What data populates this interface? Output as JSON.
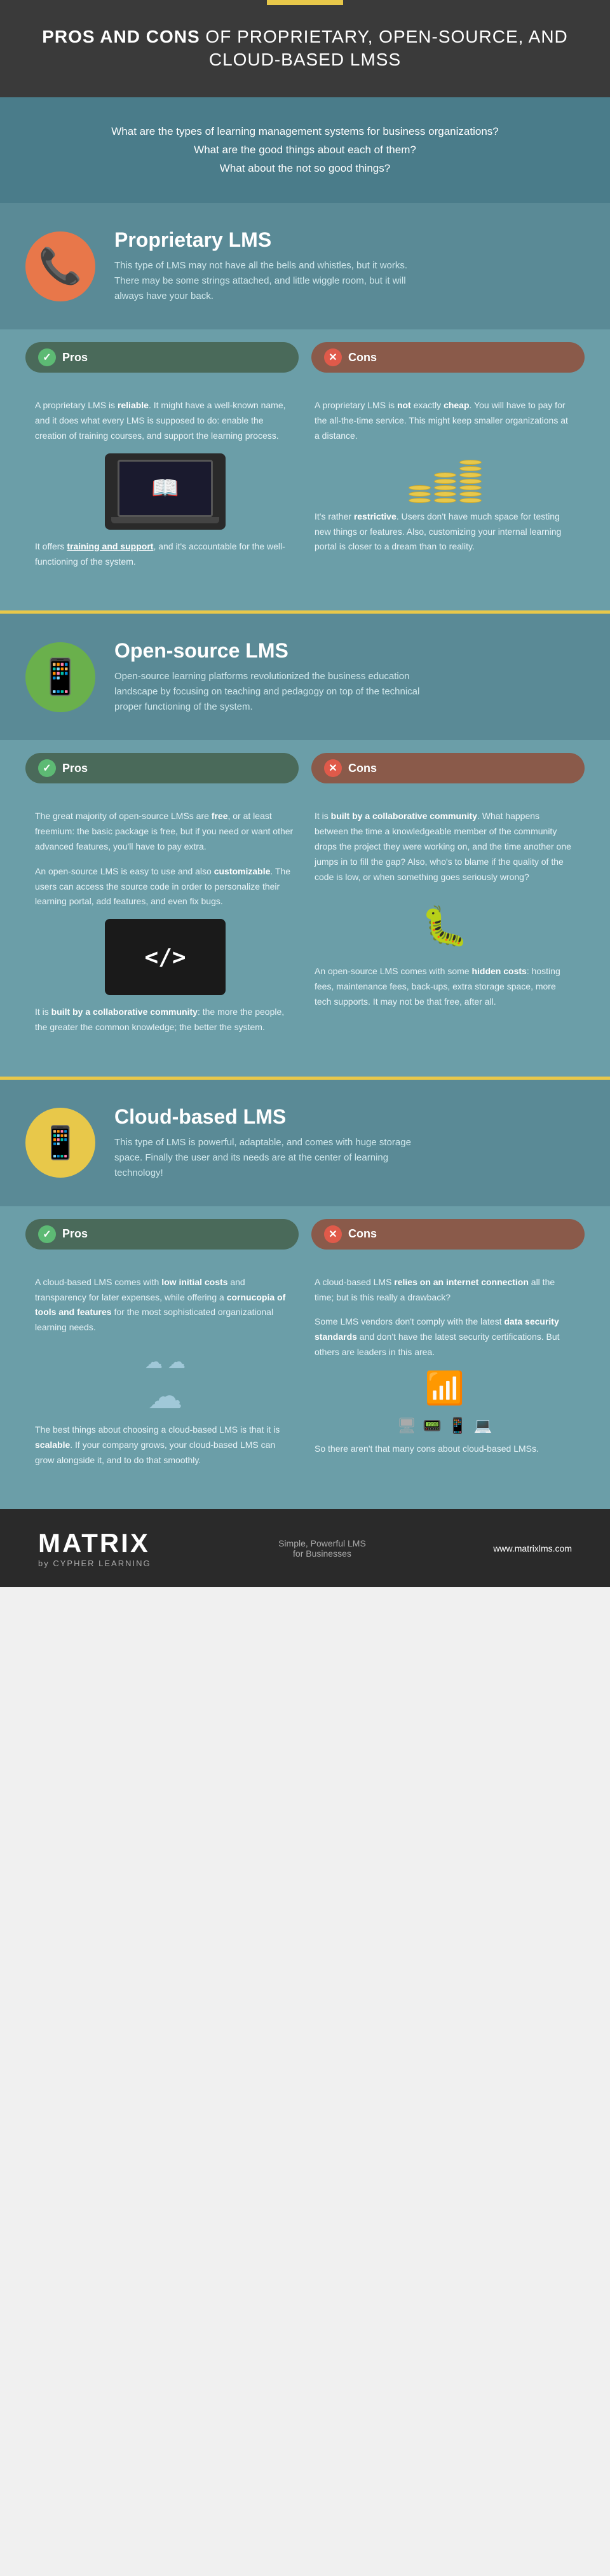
{
  "header": {
    "accent": "yellow accent bar",
    "title_normal": "PROS AND CONS",
    "title_rest": " OF PROPRIETARY, OPEN-SOURCE, AND CLOUD-BASED LMSs"
  },
  "intro": {
    "line1": "What are the types of learning management systems for business organizations?",
    "line2": "What are the good things about each of them?",
    "line3": "What about the not so good things?"
  },
  "proprietary": {
    "title": "Proprietary LMS",
    "description": "This type of LMS may not have all the bells and whistles, but it works. There may be some strings attached, and little wiggle room, but it will always have your back.",
    "pros_label": "Pros",
    "cons_label": "Cons",
    "pros": [
      {
        "text": "A proprietary LMS is reliable. It might have a well-known name, and it does what every LMS is supposed to do: enable the creation of training courses, and support the learning process."
      },
      {
        "text": "It offers training and support, and it's accountable for the well-functioning of the system."
      }
    ],
    "cons": [
      {
        "text": "A proprietary LMS is not exactly cheap. You will have to pay for the all-the-time service. This might keep smaller organizations at a distance."
      },
      {
        "text": "It's rather restrictive. Users don't have much space for testing new things or features. Also, customizing your internal learning portal is closer to a dream than to reality."
      }
    ]
  },
  "opensource": {
    "title": "Open-source LMS",
    "description": "Open-source learning platforms revolutionized the business education landscape by focusing on teaching and pedagogy on top of the technical proper functioning of the system.",
    "pros_label": "Pros",
    "cons_label": "Cons",
    "pros": [
      {
        "text": "The great majority of open-source LMSs are free, or at least freemium: the basic package is free, but if you need or want other advanced features, you'll have to pay extra."
      },
      {
        "text": "An open-source LMS is easy to use and also customizable. The users can access the source code in order to personalize their learning portal, add features, and even fix bugs."
      },
      {
        "text": "It is built by a collaborative community: the more the people, the greater the common knowledge; the better the system."
      }
    ],
    "cons": [
      {
        "text": "It is built by a collaborative community. What happens between the time a knowledgeable member of the community drops the project they were working on, and the time another one jumps in to fill the gap? Also, who's to blame if the quality of the code is low, or when something goes seriously wrong?"
      },
      {
        "text": "An open-source LMS comes with some hidden costs: hosting fees, maintenance fees, back-ups, extra storage space, more tech supports. It may not be that free, after all."
      }
    ]
  },
  "cloud": {
    "title": "Cloud-based LMS",
    "description": "This type of LMS is powerful, adaptable, and comes with huge storage space. Finally the user and its needs are at the center of learning technology!",
    "pros_label": "Pros",
    "cons_label": "Cons",
    "pros": [
      {
        "text": "A cloud-based LMS comes with low initial costs and transparency for later expenses, while offering a cornucopia of tools and features for the most sophisticated organizational learning needs."
      },
      {
        "text": "The best things about choosing a cloud-based LMS is that it is scalable. If your company grows, your cloud-based LMS can grow alongside it, and to do that smoothly."
      }
    ],
    "cons": [
      {
        "text": "A cloud-based LMS relies on an internet connection all the time; but is this really a drawback?"
      },
      {
        "text": "Some LMS vendors don't comply with the latest data security standards and don't have the latest security certifications. But others are leaders in this area."
      },
      {
        "text": "So there aren't that many cons about cloud-based LMSs."
      }
    ]
  },
  "footer": {
    "logo_matrix": "MATRIX",
    "logo_sub": "by CYPHER LEARNING",
    "tagline_line1": "Simple, Powerful LMS",
    "tagline_line2": "for Businesses",
    "url": "www.matrixlms.com"
  }
}
